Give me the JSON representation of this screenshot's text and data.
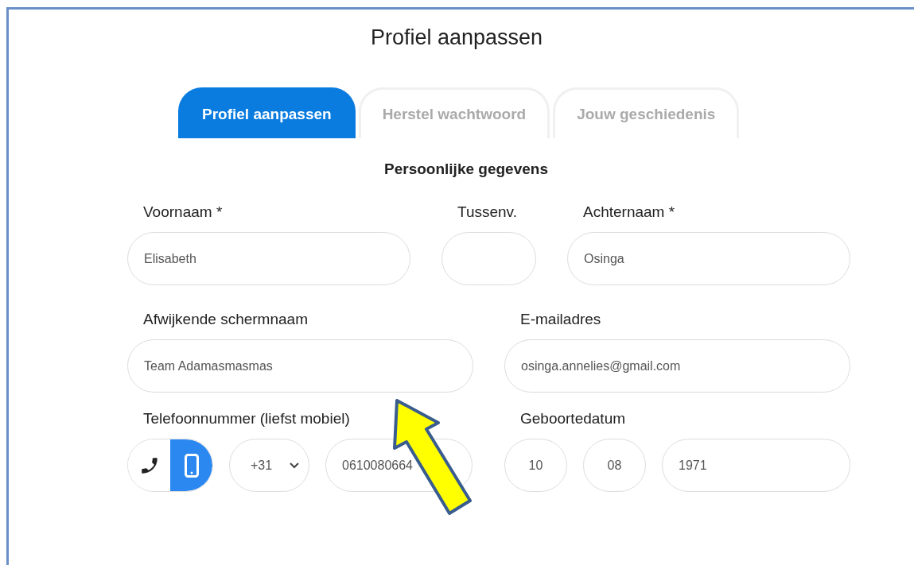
{
  "page_title": "Profiel aanpassen",
  "tabs": [
    {
      "label": "Profiel aanpassen",
      "selected": true
    },
    {
      "label": "Herstel wachtwoord",
      "selected": false
    },
    {
      "label": "Jouw geschiedenis",
      "selected": false
    }
  ],
  "section_title": "Persoonlijke gegevens",
  "rows": [
    {
      "fields": [
        {
          "label": "Voornaam *",
          "value": "Elisabeth"
        },
        {
          "label": "Tussenv."
        },
        {
          "label": "Achternaam *",
          "value": "Osinga"
        }
      ]
    },
    {
      "fields": [
        {
          "label": "Afwijkende schermnaam",
          "value": "Team Adamasmasmas"
        },
        {
          "label": "E-mailadres",
          "value": "osinga.annelies@gmail.com"
        }
      ]
    }
  ],
  "phone": {
    "label": "Telefoonnummer (liefst mobiel)",
    "types": [
      {
        "kind": "landline",
        "selected": false
      },
      {
        "kind": "mobile",
        "selected": true
      }
    ],
    "country_code": "+31",
    "value": "0610080664"
  },
  "birthdate": {
    "label": "Geboortedatum",
    "day": "10",
    "month": "08",
    "year": "1971"
  }
}
